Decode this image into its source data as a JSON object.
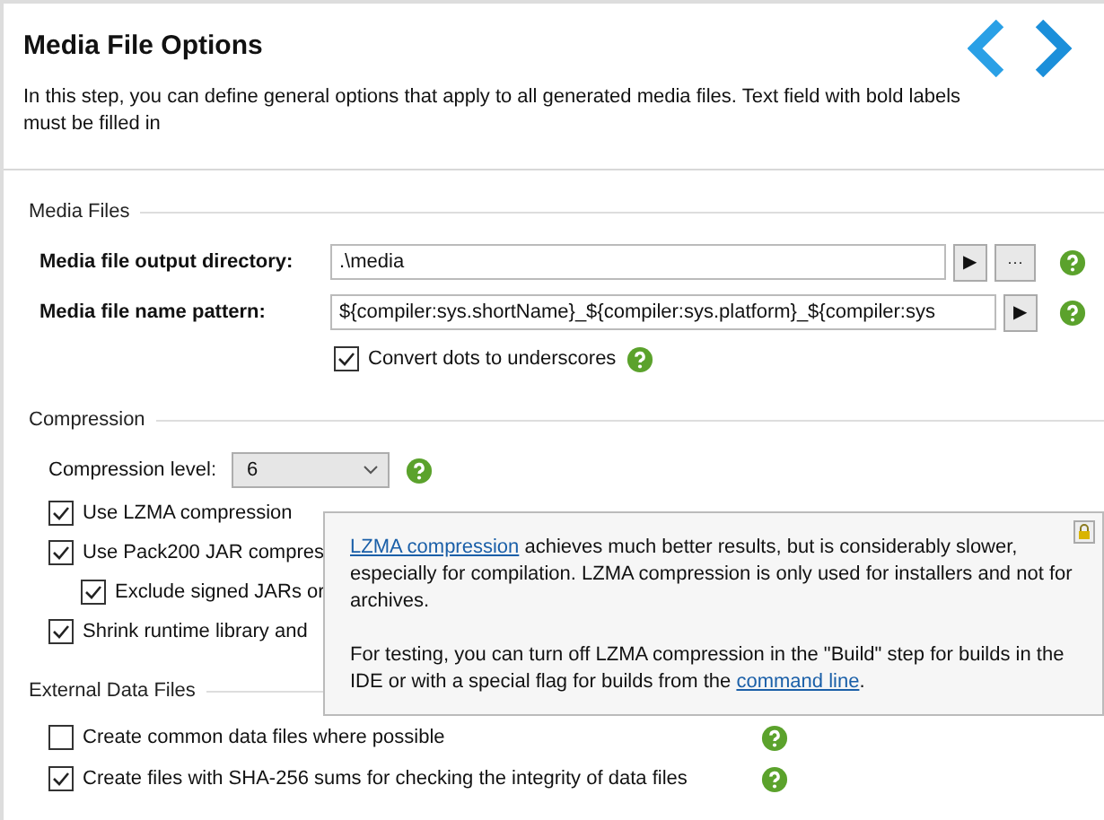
{
  "header": {
    "title": "Media File Options",
    "description": "In this step, you can define general options that apply to all generated media files. Text field with bold labels must be filled in"
  },
  "sections": [
    {
      "title": "Media Files",
      "rows": [
        {
          "kind": "field",
          "label": "Media file output directory:",
          "value": ".\\media",
          "buttons": [
            "▶",
            "···"
          ],
          "help": true
        },
        {
          "kind": "field",
          "label": "Media file name pattern:",
          "value": "${compiler:sys.shortName}_${compiler:sys.platform}_${compiler:sys",
          "buttons": [
            "▶"
          ],
          "help": true
        },
        {
          "kind": "fieldcheck",
          "label": "Convert dots to underscores",
          "checked": true,
          "help": true
        }
      ]
    },
    {
      "title": "Compression",
      "rows": [
        {
          "kind": "combo",
          "label": "Compression level:",
          "value": "6",
          "help": true
        },
        {
          "kind": "check",
          "label": "Use LZMA compression",
          "checked": true
        },
        {
          "kind": "check",
          "label": "Use Pack200 JAR compres",
          "checked": true
        },
        {
          "kind": "subcheck",
          "label": "Exclude signed JARs or",
          "checked": true
        },
        {
          "kind": "check",
          "label": "Shrink runtime library and",
          "checked": true
        }
      ]
    },
    {
      "title": "External Data Files",
      "rows": [
        {
          "kind": "check",
          "label": "Create common data files where possible",
          "checked": false,
          "help": true
        },
        {
          "kind": "check",
          "label": "Create files with SHA-256 sums for checking the integrity of data files",
          "checked": true,
          "help": true
        }
      ]
    }
  ],
  "tooltip": {
    "paragraphs": [
      [
        {
          "kind": "link",
          "text": "LZMA compression"
        },
        {
          "kind": "text",
          "text": " achieves much better results, but is considerably slower, especially for compilation. LZMA compression is only used for installers and not for archives."
        }
      ],
      [
        {
          "kind": "text",
          "text": "For testing, you can turn off LZMA compression in the \"Build\" step for builds in the IDE or with a special flag for builds from the "
        },
        {
          "kind": "link",
          "text": "command line"
        },
        {
          "kind": "text",
          "text": "."
        }
      ]
    ]
  }
}
